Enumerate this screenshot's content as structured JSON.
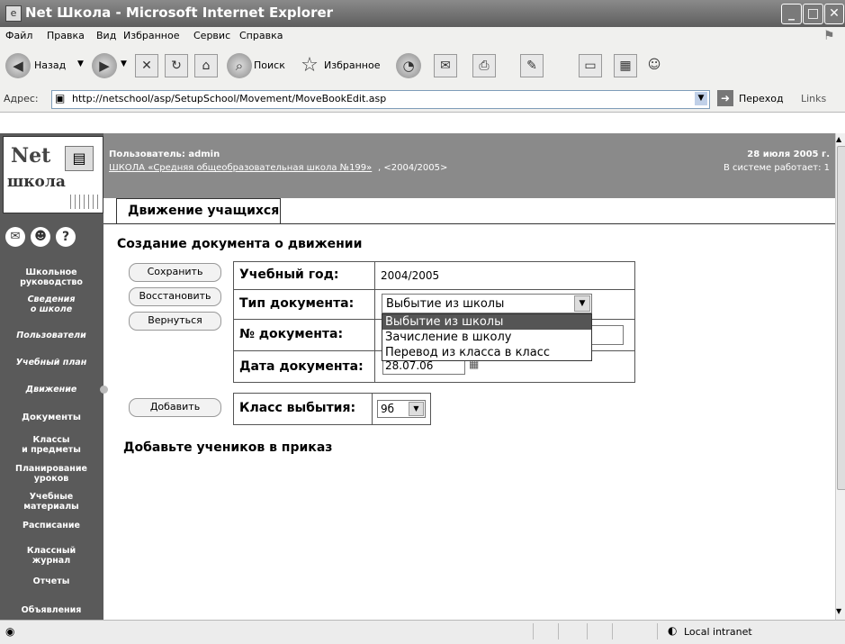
{
  "window": {
    "title": "Net Школа - Microsoft Internet Explorer"
  },
  "menu": [
    "Файл",
    "Правка",
    "Вид",
    "Избранное",
    "Сервис",
    "Справка"
  ],
  "toolbar": {
    "back": "Назад",
    "search": "Поиск",
    "favorites": "Избранное"
  },
  "address": {
    "label": "Адрес:",
    "url": "http://netschool/asp/SetupSchool/Movement/MoveBookEdit.asp",
    "go": "Переход",
    "links": "Links"
  },
  "header": {
    "user": "Пользователь: admin",
    "school_link": "ШКОЛА «Средняя общеобразовательная школа №199»",
    "year": ", <2004/2005>",
    "date": "28 июля 2005 г.",
    "online": "В системе работает: 1"
  },
  "logo": {
    "top": "Net",
    "bottom": "школа"
  },
  "tab": "Движение учащихся",
  "page_title": "Создание документа о движении",
  "sidebar": {
    "items": [
      "Школьное\nруководство",
      "Сведения\nо школе",
      "Пользователи",
      "Учебный план",
      "Движение",
      "Документы",
      "Классы\nи предметы",
      "Планирование\nуроков",
      "Учебные\nматериалы",
      "Расписание",
      "Классный\nжурнал",
      "Отчеты",
      "Объявления"
    ]
  },
  "buttons": {
    "save": "Сохранить",
    "restore": "Восстановить",
    "back": "Вернуться",
    "add": "Добавить"
  },
  "form": {
    "year_label": "Учебный год:",
    "year_value": "2004/2005",
    "type_label": "Тип документа:",
    "type_value": "Выбытие из школы",
    "type_options": [
      "Выбытие из школы",
      "Зачисление в школу",
      "Перевод из класса в класс"
    ],
    "number_label": "№ документа:",
    "date_label": "Дата документа:",
    "date_value": "28.07.06",
    "class_label": "Класс выбытия:",
    "class_value": "9б"
  },
  "hint": "Добавьте учеников в приказ",
  "status": {
    "zone": "Local intranet"
  }
}
